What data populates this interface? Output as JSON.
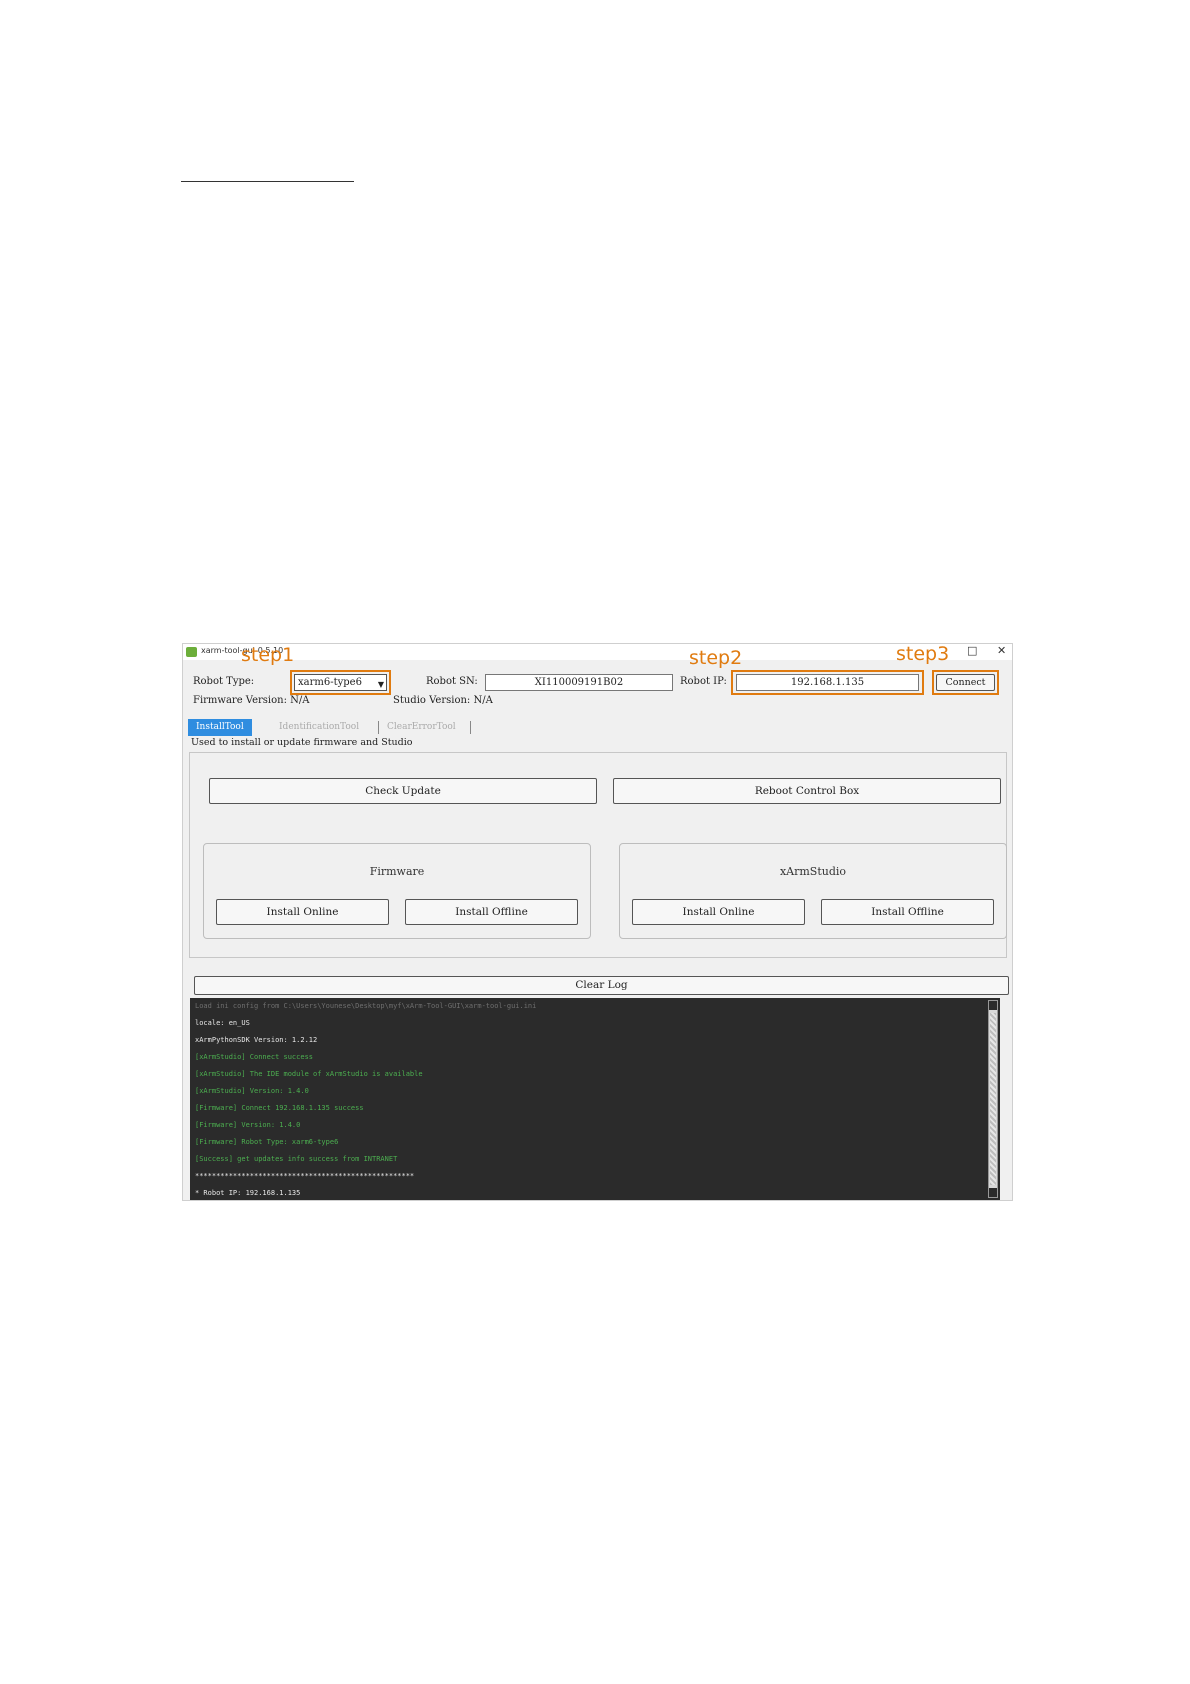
{
  "window": {
    "title": "xarm-tool-gui-0.5.10",
    "controls": {
      "maximize": "□",
      "close": "✕"
    }
  },
  "annotations": {
    "step1": "step1",
    "step2": "step2",
    "step3": "step3",
    "highlight_color": "#e07b10"
  },
  "header": {
    "robot_type_label": "Robot Type:",
    "robot_type_value": "xarm6-type6",
    "robot_sn_label": "Robot SN:",
    "robot_sn_value": "XI110009191B02",
    "robot_ip_label": "Robot IP:",
    "robot_ip_value": "192.168.1.135",
    "connect_label": "Connect",
    "firmware_version": "Firmware Version: N/A",
    "studio_version": "Studio Version: N/A"
  },
  "tabs": [
    {
      "label": "InstallTool",
      "active": true
    },
    {
      "label": "IdentificationTool",
      "active": false
    },
    {
      "label": "ClearErrorTool",
      "active": false
    }
  ],
  "tab_description": "Used to install or update firmware and Studio",
  "actions": {
    "check_update": "Check Update",
    "reboot_control_box": "Reboot Control Box"
  },
  "firmware_group": {
    "title": "Firmware",
    "install_online": "Install Online",
    "install_offline": "Install Offline"
  },
  "studio_group": {
    "title": "xArmStudio",
    "install_online": "Install Online",
    "install_offline": "Install Offline"
  },
  "clear_log": "Clear Log",
  "log": [
    {
      "text": "Load ini config from C:\\Users\\Younese\\Desktop\\myf\\xArm-Tool-GUI\\xarm-tool-gui.ini",
      "color": "#6f6f6f"
    },
    {
      "text": "locale: en_US",
      "color": "#e8e8e8"
    },
    {
      "text": "xArmPythonSDK Version: 1.2.12",
      "color": "#e8e8e8"
    },
    {
      "text": "[xArmStudio] Connect success",
      "color": "#4caf50"
    },
    {
      "text": "[xArmStudio] The IDE module of xArmStudio is available",
      "color": "#4caf50"
    },
    {
      "text": "[xArmStudio] Version: 1.4.0",
      "color": "#4caf50"
    },
    {
      "text": "[Firmware] Connect 192.168.1.135 success",
      "color": "#4caf50"
    },
    {
      "text": "[Firmware] Version: 1.4.0",
      "color": "#4caf50"
    },
    {
      "text": "[Firmware] Robot Type: xarm6-type6",
      "color": "#4caf50"
    },
    {
      "text": "[Success] get updates info success from INTRANET",
      "color": "#4caf50"
    },
    {
      "text": "****************************************************",
      "color": "#e8e8e8"
    },
    {
      "text": "* Robot IP: 192.168.1.135",
      "color": "#e8e8e8"
    }
  ]
}
